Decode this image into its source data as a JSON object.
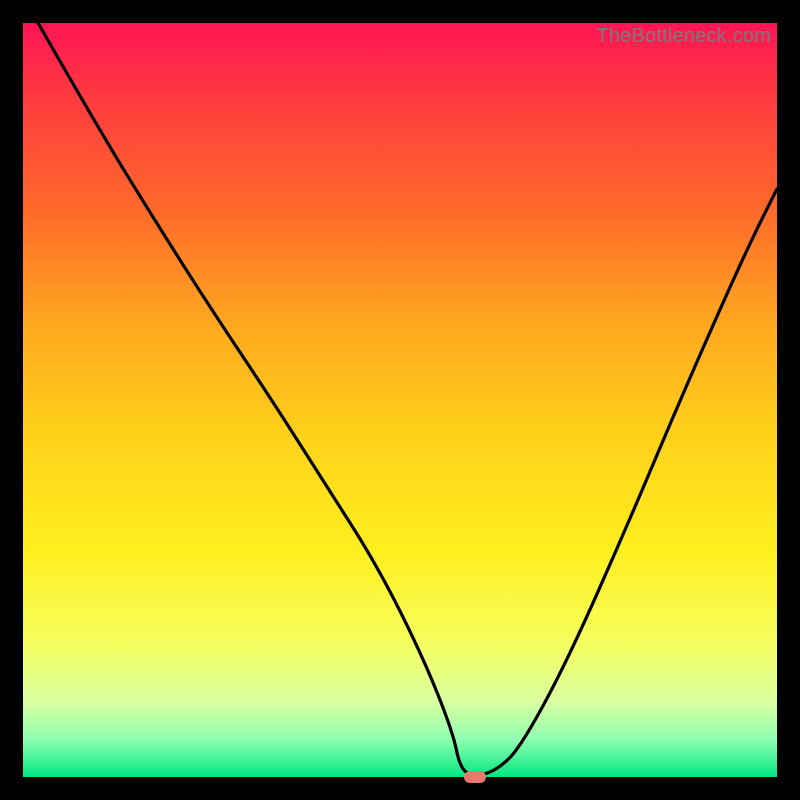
{
  "watermark": "TheBottleneck.com",
  "chart_data": {
    "type": "line",
    "title": "",
    "xlabel": "",
    "ylabel": "",
    "xlim": [
      0,
      100
    ],
    "ylim": [
      0,
      100
    ],
    "grid": false,
    "legend": false,
    "background": "rainbow-vertical",
    "series": [
      {
        "name": "bottleneck-curve",
        "color": "#000000",
        "x": [
          2,
          10,
          18,
          25,
          33,
          40,
          47,
          53,
          57,
          58,
          60,
          63,
          66,
          72,
          80,
          88,
          96,
          100
        ],
        "y": [
          100,
          86,
          73,
          62,
          50,
          39,
          28,
          16,
          6,
          1,
          0,
          1,
          4,
          15,
          33,
          52,
          70,
          78
        ]
      }
    ],
    "marker": {
      "x": 60,
      "y": 0,
      "color": "#e77a6a"
    }
  }
}
